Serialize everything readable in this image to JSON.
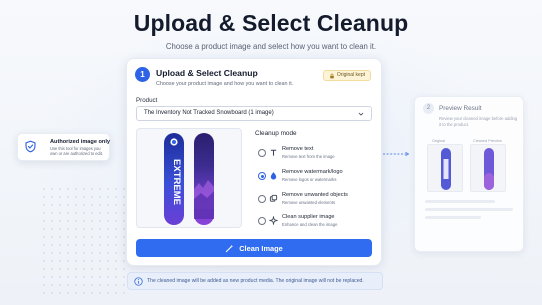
{
  "hero": {
    "title": "Upload & Select Cleanup",
    "subtitle": "Choose a product image and select how you want to clean it."
  },
  "card": {
    "step_number": "1",
    "title": "Upload & Select Cleanup",
    "subtitle": "Choose your product image and how you want to clean it.",
    "tag": "Original kept",
    "product_label": "Product",
    "product_value": "The Inventory Not Tracked Snowboard (1 image)",
    "board_text": "EXTREME",
    "cleanup_label": "Cleanup mode",
    "options": [
      {
        "title": "Remove text",
        "desc": "Remove text from the image",
        "selected": false,
        "icon": "text-icon"
      },
      {
        "title": "Remove watermark/logo",
        "desc": "Remove logos or watermarks",
        "selected": true,
        "icon": "drop-icon"
      },
      {
        "title": "Remove unwanted objects",
        "desc": "Remove unwanted elements",
        "selected": false,
        "icon": "objects-icon"
      },
      {
        "title": "Clean supplier image",
        "desc": "Enhance and clean the image",
        "selected": false,
        "icon": "sparkle-icon"
      }
    ],
    "button": "Clean Image"
  },
  "info": {
    "text": "The cleaned image will be added as new product media. The original image will not be replaced."
  },
  "auth": {
    "title": "Authorized image only",
    "desc": "Use this tool for images you own or are authorized to edit."
  },
  "preview": {
    "step_number": "2",
    "title": "Preview Result",
    "desc": "Review your cleaned image before adding it to the product.",
    "original_label": "Original",
    "cleaned_label": "Cleaned Preview"
  },
  "colors": {
    "accent": "#2f6cf0",
    "board_top": "#1f3fb0",
    "board_bottom": "#7a2fd0"
  }
}
